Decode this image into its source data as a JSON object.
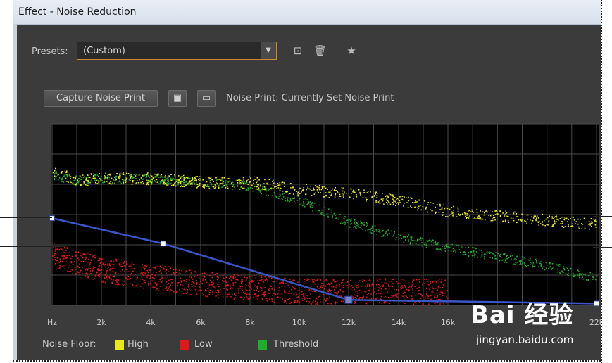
{
  "window": {
    "title": "Effect - Noise Reduction"
  },
  "presets": {
    "label": "Presets:",
    "value": "(Custom)"
  },
  "toolbar": {
    "save_icon": "save-preset-icon",
    "delete_icon": "trash-icon",
    "favorite_icon": "star-icon"
  },
  "noise_print": {
    "capture_label": "Capture Noise Print",
    "label": "Noise Print:",
    "value": "Currently Set Noise Print"
  },
  "graph": {
    "x_ticks": [
      "Hz",
      "2k",
      "4k",
      "6k",
      "8k",
      "10k",
      "12k",
      "14k",
      "16k",
      "22k"
    ]
  },
  "legend": {
    "label": "Noise Floor:",
    "items": [
      {
        "name": "High",
        "color": "#e8e81a"
      },
      {
        "name": "Low",
        "color": "#e01818"
      },
      {
        "name": "Threshold",
        "color": "#1fae2c"
      }
    ]
  },
  "watermark": {
    "logo": "Bai 经验",
    "url": "jingyan.baidu.com"
  },
  "chart_data": {
    "type": "scatter",
    "x_unit": "Hz",
    "series": [
      {
        "name": "High",
        "x": [
          0,
          1000,
          2000,
          4000,
          6000,
          8000,
          10000,
          12000,
          14000,
          16000,
          20000,
          22000
        ],
        "y": [
          74,
          69,
          70,
          70,
          68,
          68,
          64,
          62,
          58,
          52,
          47,
          45
        ]
      },
      {
        "name": "Threshold",
        "x": [
          0,
          1000,
          2000,
          4000,
          6000,
          8000,
          10000,
          12000,
          14000,
          16000,
          20000,
          22000
        ],
        "y": [
          72,
          69,
          70,
          70,
          68,
          66,
          58,
          46,
          38,
          32,
          22,
          15
        ]
      },
      {
        "name": "Low",
        "x": [
          0,
          2000,
          4000,
          6000,
          8000,
          10000,
          12000,
          14000,
          16000
        ],
        "y": [
          28,
          20,
          16,
          12,
          10,
          8,
          8,
          8,
          8
        ]
      }
    ]
  },
  "colors": {
    "accent": "#c98a2d",
    "panel": "#3b3b3b",
    "graph_bg": "#000000",
    "curve": "#3b56c9"
  }
}
